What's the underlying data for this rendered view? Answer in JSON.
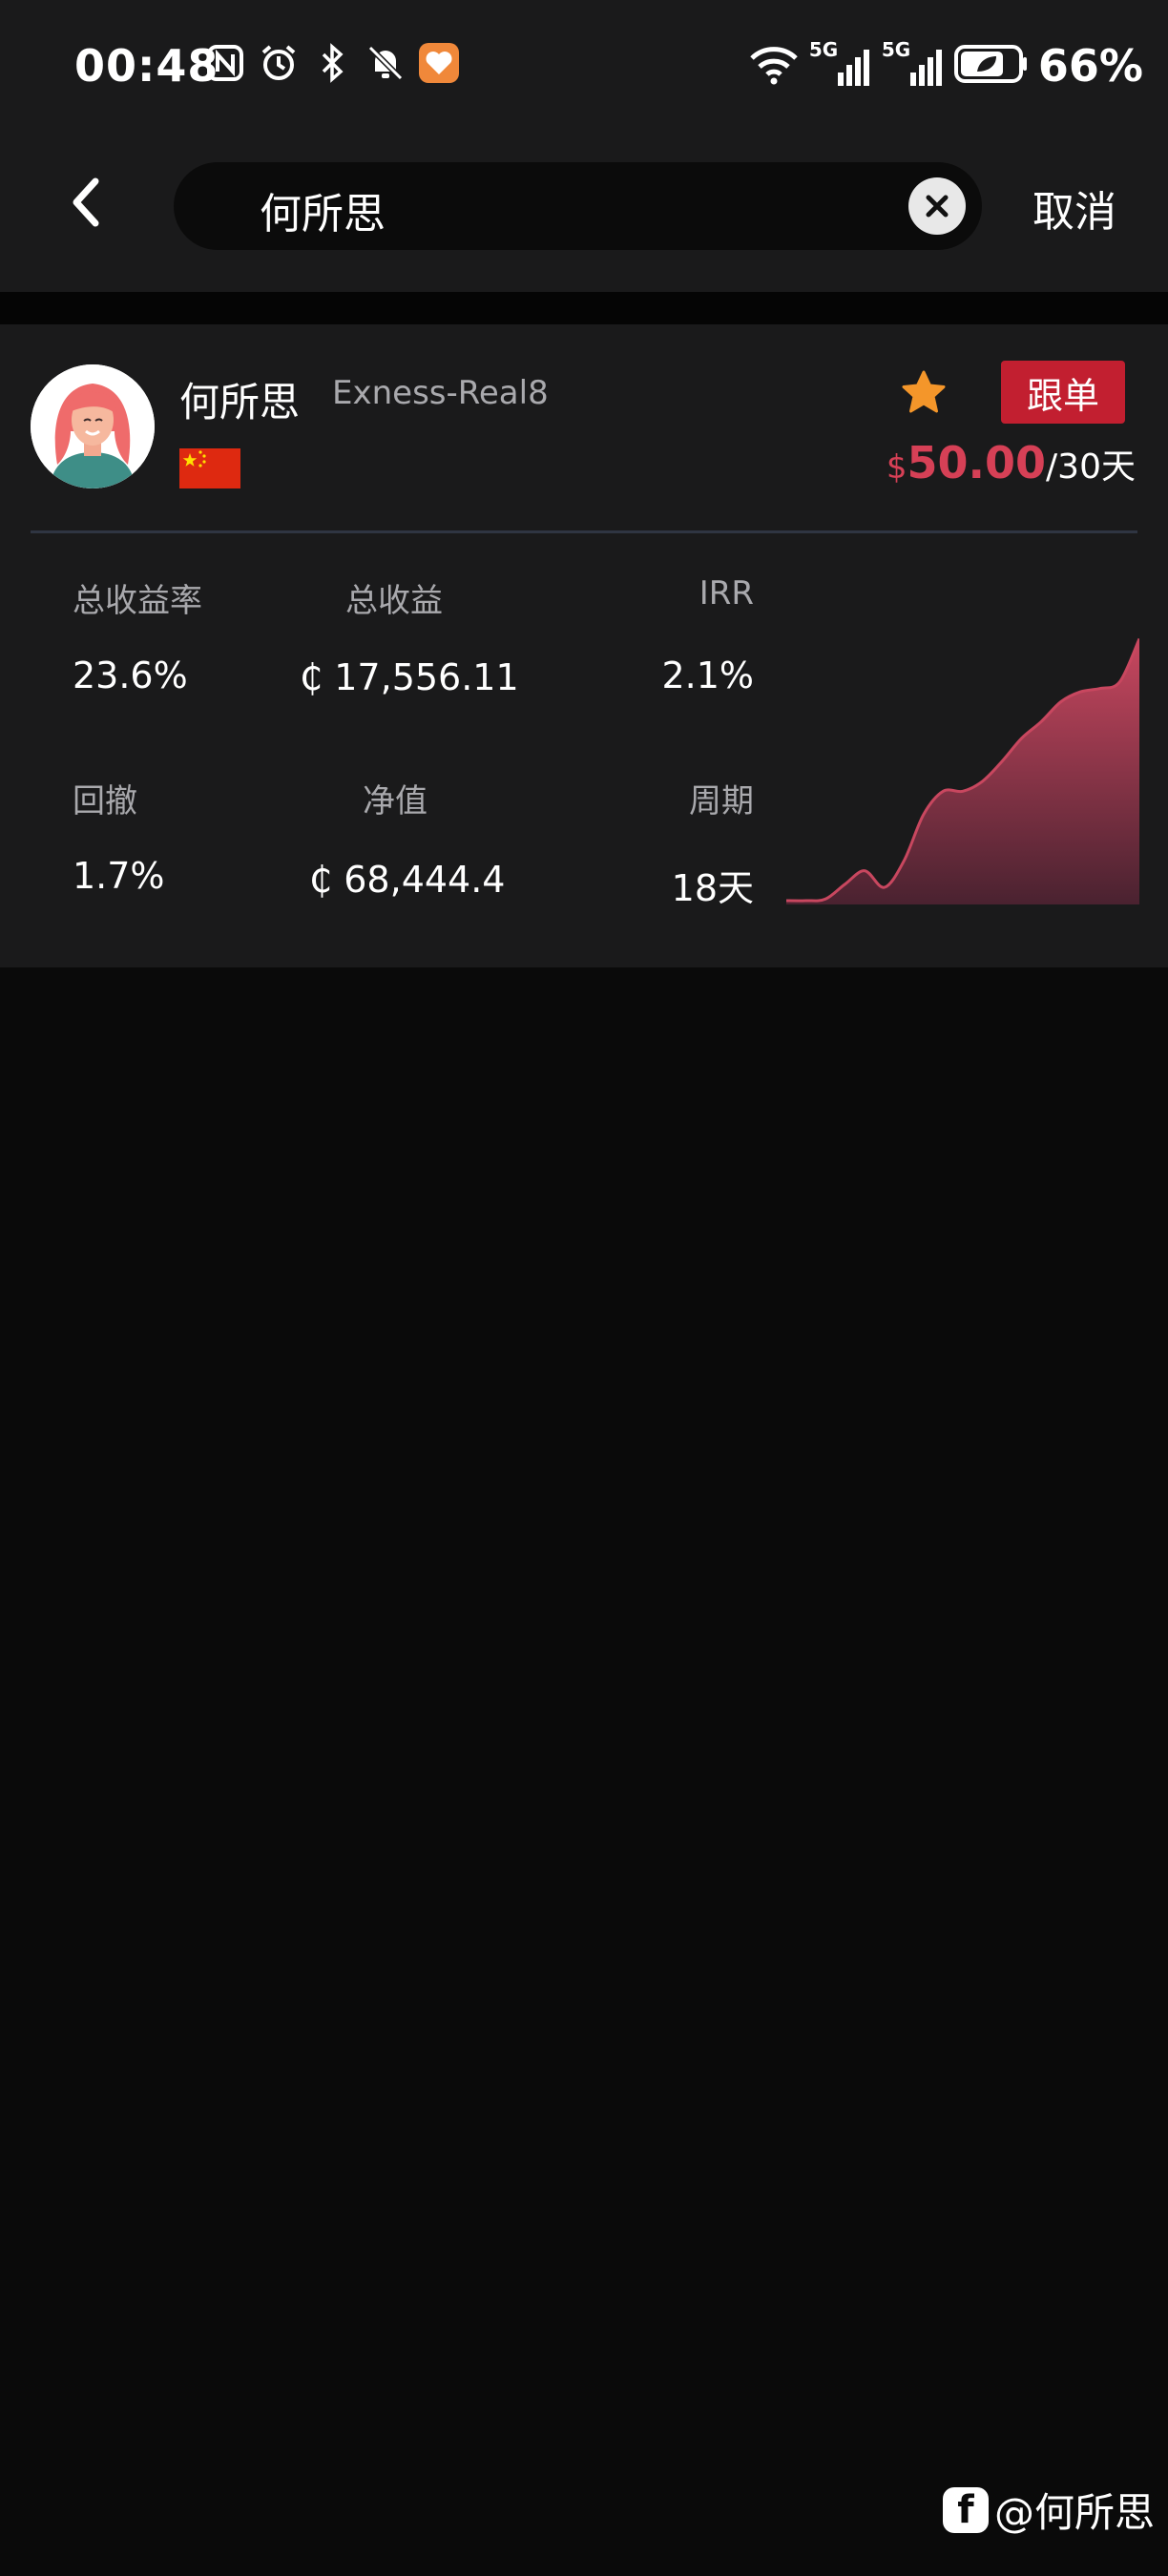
{
  "status_bar": {
    "time": "00:48",
    "battery_percent": "66%",
    "network_label_1": "5G",
    "network_label_2": "5G",
    "icons_left": [
      "nfc-icon",
      "alarm-icon",
      "bluetooth-icon",
      "mute-icon",
      "health-app-icon"
    ],
    "icons_right": [
      "wifi-icon",
      "signal-icon",
      "signal-icon",
      "battery-icon"
    ]
  },
  "search": {
    "value": "何所思",
    "cancel_label": "取消"
  },
  "result": {
    "name": "何所思",
    "server": "Exness-Real8",
    "follow_label": "跟单",
    "price_currency": "$",
    "price_amount": "50.00",
    "price_period": "/30天",
    "stats": {
      "total_return_rate_label": "总收益率",
      "total_return_rate": "23.6%",
      "total_profit_label": "总收益",
      "total_profit": "₵ 17,556.11",
      "irr_label": "IRR",
      "irr": "2.1%",
      "drawdown_label": "回撤",
      "drawdown": "1.7%",
      "net_value_label": "净值",
      "net_value": "₵ 68,444.4",
      "period_label": "周期",
      "period": "18天"
    }
  },
  "chart_data": {
    "type": "area",
    "x": [
      0,
      1,
      2,
      3,
      4,
      5,
      6,
      7,
      8,
      9,
      10,
      11,
      12,
      13,
      14,
      15,
      16,
      17,
      18
    ],
    "values": [
      0,
      0,
      0.5,
      5,
      9,
      4,
      12,
      26,
      33,
      33,
      36,
      42,
      49,
      54,
      60,
      63,
      64,
      66,
      79
    ],
    "ylim": [
      0,
      80
    ],
    "color": "#c8475f",
    "grid": false,
    "legend": "none"
  },
  "watermark": {
    "text": "@何所思"
  },
  "colors": {
    "accent": "#c21f30",
    "price": "#d64056",
    "star": "#f4962a",
    "background": "#0a0a0a",
    "card": "#1a1a1b"
  }
}
